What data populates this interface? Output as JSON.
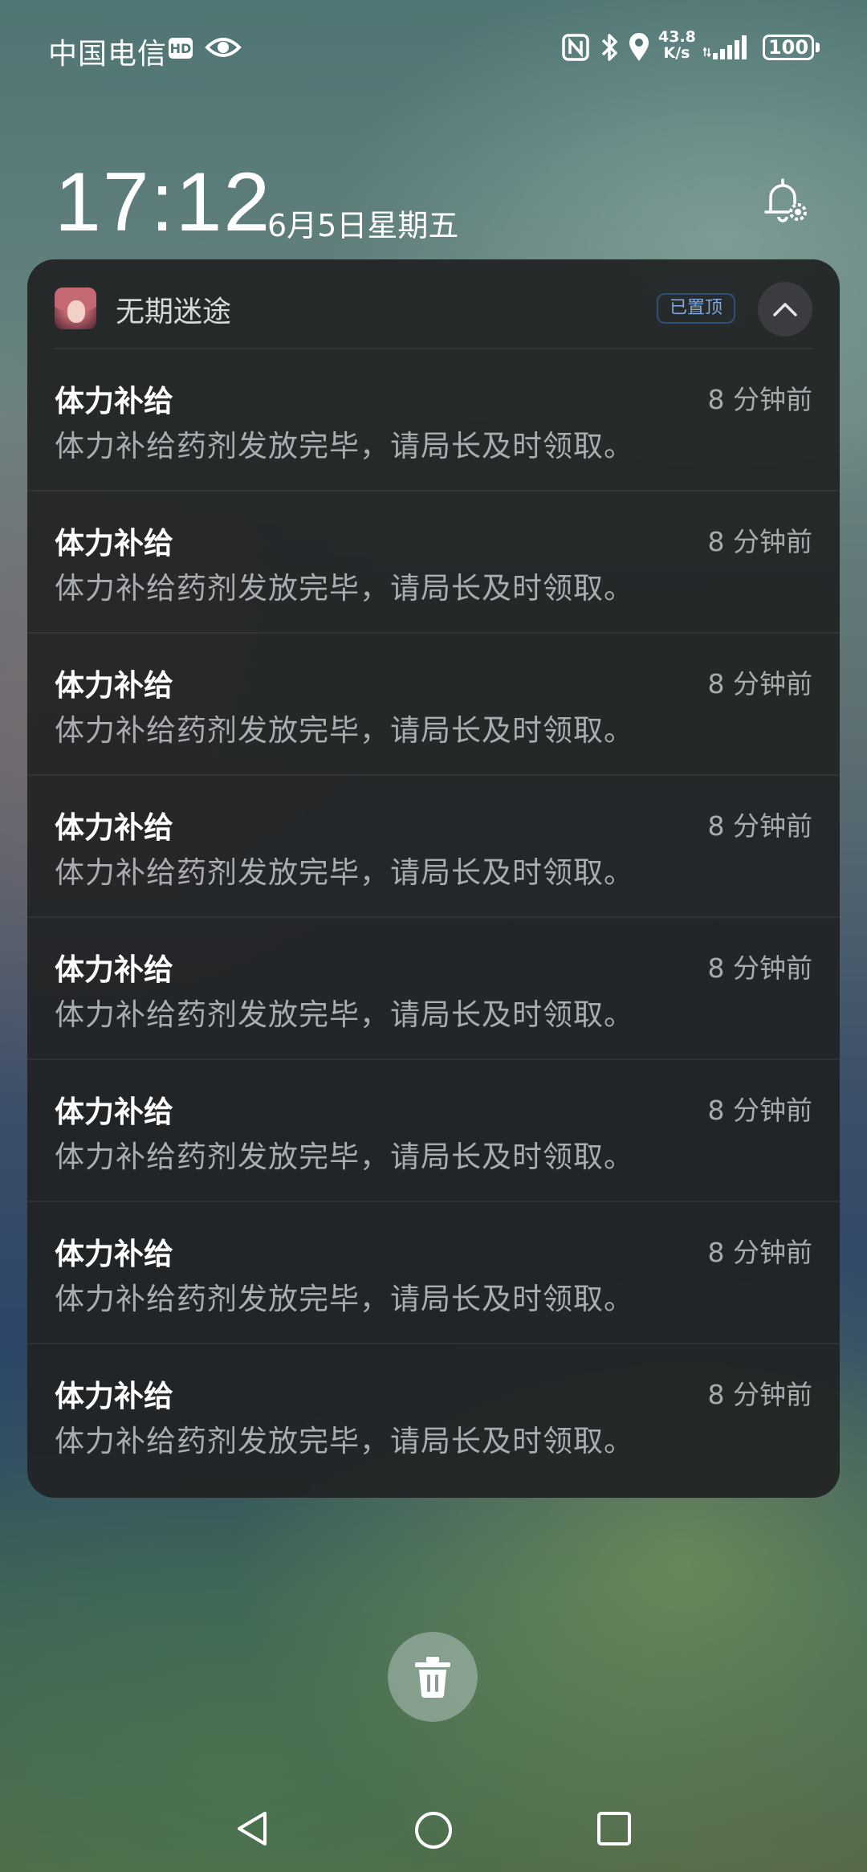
{
  "status_bar": {
    "carrier": "中国电信",
    "hd_label": "HD",
    "net_speed_value": "43.8",
    "net_speed_unit": "K/s",
    "battery": "100"
  },
  "lockscreen": {
    "time": "17:12",
    "date": "6月5日星期五"
  },
  "notification_group": {
    "app_name": "无期迷途",
    "pinned_label": "已置顶",
    "items": [
      {
        "title": "体力补给",
        "time": "8 分钟前",
        "body": "体力补给药剂发放完毕，请局长及时领取。"
      },
      {
        "title": "体力补给",
        "time": "8 分钟前",
        "body": "体力补给药剂发放完毕，请局长及时领取。"
      },
      {
        "title": "体力补给",
        "time": "8 分钟前",
        "body": "体力补给药剂发放完毕，请局长及时领取。"
      },
      {
        "title": "体力补给",
        "time": "8 分钟前",
        "body": "体力补给药剂发放完毕，请局长及时领取。"
      },
      {
        "title": "体力补给",
        "time": "8 分钟前",
        "body": "体力补给药剂发放完毕，请局长及时领取。"
      },
      {
        "title": "体力补给",
        "time": "8 分钟前",
        "body": "体力补给药剂发放完毕，请局长及时领取。"
      },
      {
        "title": "体力补给",
        "time": "8 分钟前",
        "body": "体力补给药剂发放完毕，请局长及时领取。"
      },
      {
        "title": "体力补给",
        "time": "8 分钟前",
        "body": "体力补给药剂发放完毕，请局长及时领取。"
      }
    ]
  },
  "colors": {
    "card_background": "#202224",
    "pinned_badge_text": "#7fa8e0",
    "secondary_text": "#a9acb0"
  },
  "icons": {
    "status": [
      "eye-icon",
      "nfc-icon",
      "bluetooth-icon",
      "location-icon",
      "signal-icon",
      "battery-icon"
    ],
    "clock_area": "bell-settings-icon",
    "card": [
      "app-avatar",
      "chevron-up-icon"
    ],
    "bottom": [
      "trash-icon",
      "nav-back-icon",
      "nav-home-icon",
      "nav-recent-icon"
    ]
  }
}
